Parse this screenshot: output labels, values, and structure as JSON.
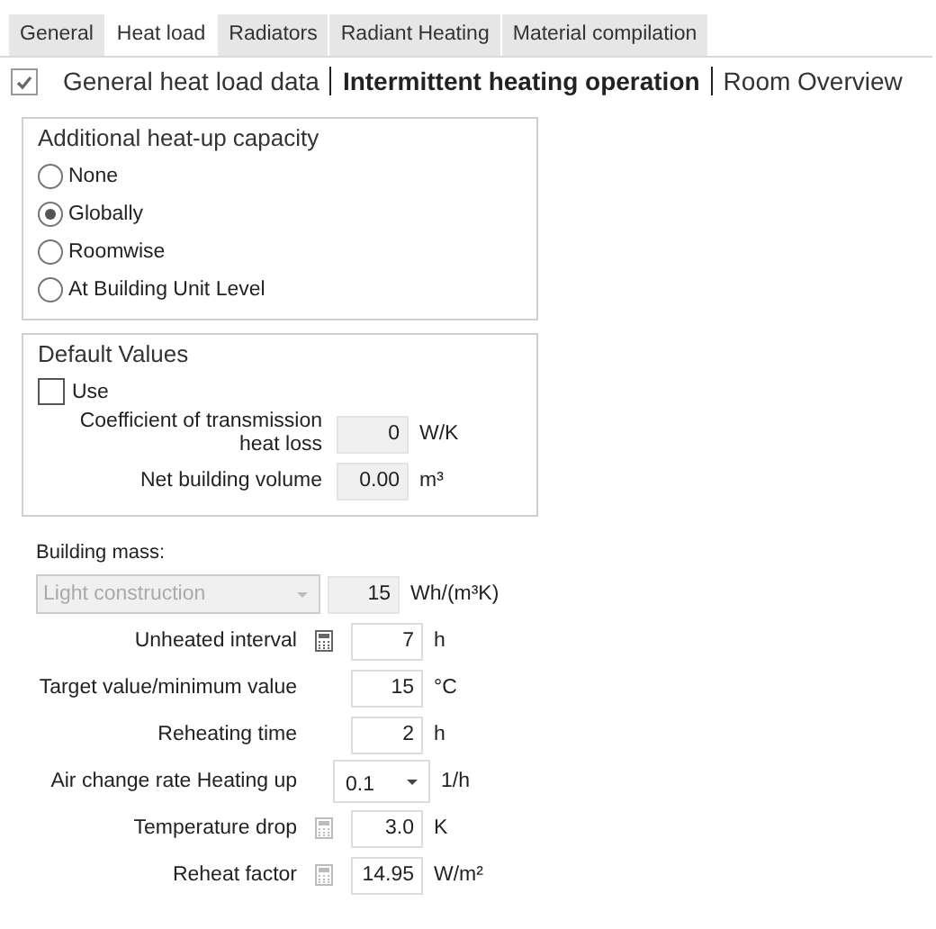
{
  "tabs": [
    {
      "label": "General",
      "selected": false
    },
    {
      "label": "Heat load",
      "selected": true
    },
    {
      "label": "Radiators",
      "selected": false
    },
    {
      "label": "Radiant Heating",
      "selected": false
    },
    {
      "label": "Material compilation",
      "selected": false
    }
  ],
  "subnav": {
    "checked": true,
    "items": [
      {
        "label": "General heat load data",
        "selected": false
      },
      {
        "label": "Intermittent heating operation",
        "selected": true
      },
      {
        "label": "Room Overview",
        "selected": false
      }
    ]
  },
  "heatup_group": {
    "title": "Additional heat-up capacity",
    "options": [
      {
        "label": "None",
        "selected": false
      },
      {
        "label": "Globally",
        "selected": true
      },
      {
        "label": "Roomwise",
        "selected": false
      },
      {
        "label": "At Building Unit Level",
        "selected": false
      }
    ]
  },
  "defaults_group": {
    "title": "Default Values",
    "use": {
      "label": "Use",
      "checked": false
    },
    "fields": [
      {
        "label": "Coefficient of transmission heat loss",
        "value": "0",
        "unit": "W/K",
        "disabled": true
      },
      {
        "label": "Net building volume",
        "value": "0.00",
        "unit": "m³",
        "disabled": true
      }
    ]
  },
  "building_mass": {
    "label": "Building mass:",
    "select": {
      "value": "Light construction",
      "disabled": true
    },
    "value": "15",
    "unit": "Wh/(m³K)",
    "disabled": true
  },
  "rows": [
    {
      "kind": "field",
      "label": "Unheated interval",
      "calculator": true,
      "calculator_disabled": false,
      "value": "7",
      "unit": "h"
    },
    {
      "kind": "field",
      "label": "Target value/minimum value",
      "calculator": false,
      "value": "15",
      "unit": "°C"
    },
    {
      "kind": "field",
      "label": "Reheating time",
      "calculator": false,
      "value": "2",
      "unit": "h"
    },
    {
      "kind": "dropdown",
      "label": "Air change rate Heating up",
      "calculator": false,
      "value": "0.1",
      "unit": "1/h"
    },
    {
      "kind": "field",
      "label": "Temperature drop",
      "calculator": true,
      "calculator_disabled": true,
      "value": "3.0",
      "unit": "K"
    },
    {
      "kind": "field",
      "label": "Reheat factor",
      "calculator": true,
      "calculator_disabled": true,
      "value": "14.95",
      "unit": "W/m²"
    }
  ]
}
